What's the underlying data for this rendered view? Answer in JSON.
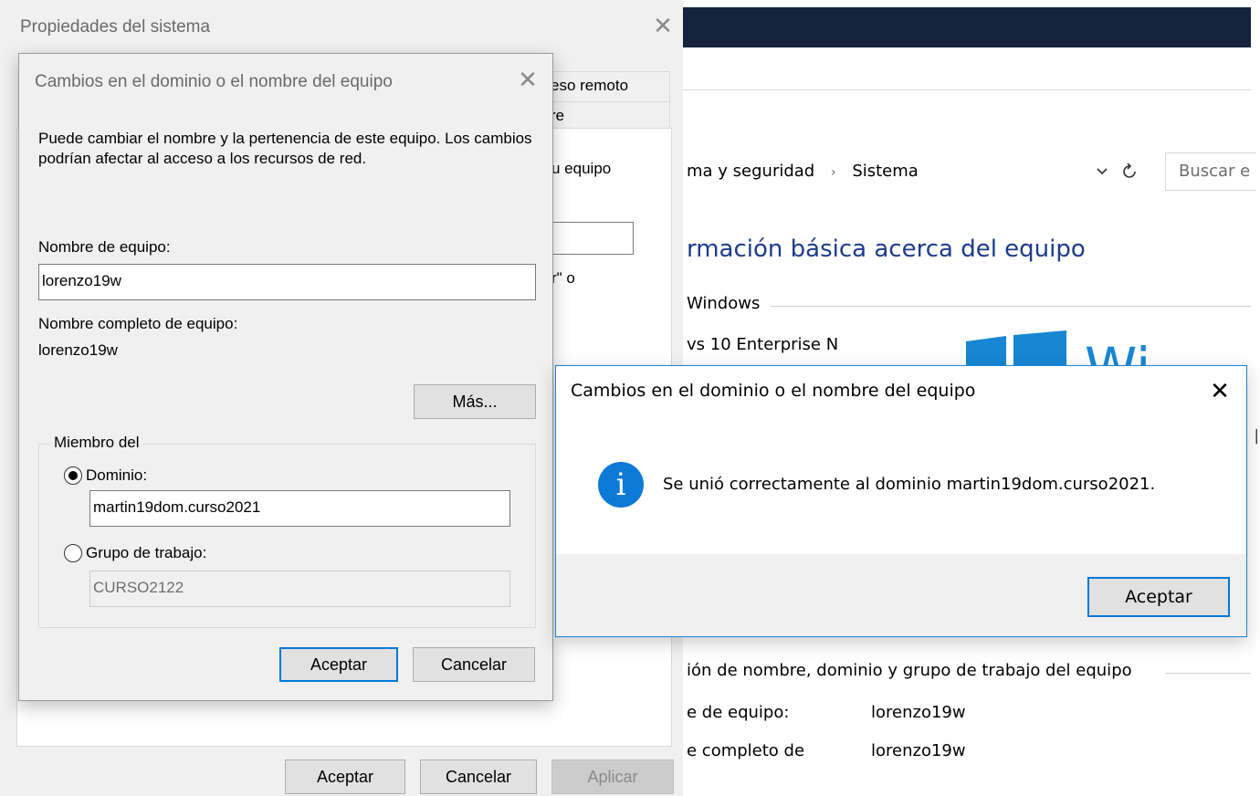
{
  "background_window": {
    "address_segments": [
      "ma y seguridad",
      "Sistema"
    ],
    "address_separator": "›",
    "address_chevron": "chevron-down-icon",
    "refresh_icon": "refresh-icon",
    "search_placeholder": "Buscar e",
    "info_title": "rmación básica acerca del equipo",
    "edition_group_label": "Windows",
    "edition": "vs 10 Enterprise N",
    "logo_text": "Wi",
    "name_group_label": "ión de nombre, dominio y grupo de trabajo del equipo",
    "computer_name_label": "e de equipo:",
    "computer_name_value": "lorenzo19w",
    "full_name_label": "e completo de",
    "full_name_value": "lorenzo19w",
    "title_bar_color": "#16233d",
    "link_color": "#1e3b8c"
  },
  "system_properties": {
    "title": "Propiedades del sistema",
    "tab_fragments": [
      "eso remoto",
      "re"
    ],
    "page_fragments": [
      "u equipo",
      "r\" o"
    ],
    "buttons": {
      "ok": "Aceptar",
      "cancel": "Cancelar",
      "apply": "Aplicar"
    }
  },
  "domain_dialog": {
    "title": "Cambios en el dominio o el nombre del equipo",
    "description": "Puede cambiar el nombre y la pertenencia de este equipo. Los cambios podrían afectar al acceso a los recursos de red.",
    "computer_name_label": "Nombre de equipo:",
    "computer_name_value": "lorenzo19w",
    "full_name_label": "Nombre completo de equipo:",
    "full_name_value": "lorenzo19w",
    "more_button": "Más...",
    "member_of_label": "Miembro del",
    "domain_option": "Dominio:",
    "domain_value": "martin19dom.curso2021",
    "workgroup_option": "Grupo de trabajo:",
    "workgroup_value": "CURSO2122",
    "selected_option": "domain",
    "ok_button": "Aceptar",
    "cancel_button": "Cancelar"
  },
  "message_box": {
    "title": "Cambios en el dominio o el nombre del equipo",
    "icon": "info-icon",
    "icon_color": "#0c79d7",
    "message": "Se unió correctamente al dominio martin19dom.curso2021.",
    "ok_button": "Aceptar",
    "border_color": "#1883d7"
  },
  "close_glyph": "✕"
}
